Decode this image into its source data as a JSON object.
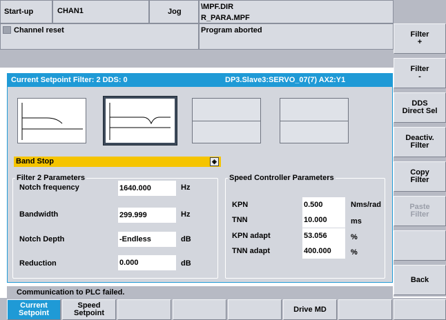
{
  "header": {
    "area": "Start-up",
    "channel": "CHAN1",
    "mode": "Jog",
    "program_dir": "\\MPF.DIR",
    "program_name": "R_PARA.MPF",
    "channel_status": "Channel reset",
    "program_status": "Program aborted"
  },
  "filter_panel": {
    "title_left": "Current Setpoint Filter:  2  DDS: 0",
    "title_right": "DP3.Slave3:SERVO_07(7)  AX2:Y1",
    "selected_filter_type": "Band Stop",
    "filter_group": {
      "title": "Filter 2 Parameters",
      "rows": [
        {
          "label": "Notch frequency",
          "value": "1640.000",
          "unit": "Hz"
        },
        {
          "label": "Bandwidth",
          "value": "299.999",
          "unit": "Hz"
        },
        {
          "label": "Notch Depth",
          "value": "-Endless",
          "unit": "dB"
        },
        {
          "label": "Reduction",
          "value": "0.000",
          "unit": "dB"
        }
      ]
    },
    "speed_group": {
      "title": "Speed Controller Parameters",
      "rows": [
        {
          "label": "KPN",
          "value": "0.500",
          "unit": "Nms/rad"
        },
        {
          "label": "TNN",
          "value": "10.000",
          "unit": "ms"
        },
        {
          "label": "KPN adapt",
          "value": "53.056",
          "unit": "%"
        },
        {
          "label": "TNN adapt",
          "value": "400.000",
          "unit": "%"
        }
      ]
    }
  },
  "status_message": "Communication to PLC failed.",
  "vertical_softkeys": [
    {
      "label": "Filter\n+",
      "enabled": true
    },
    {
      "label": "Filter\n-",
      "enabled": true
    },
    {
      "label": "DDS\nDirect Sel",
      "enabled": true
    },
    {
      "label": "Deactiv.\nFilter",
      "enabled": true
    },
    {
      "label": "Copy\nFilter",
      "enabled": true
    },
    {
      "label": "Paste\nFilter",
      "enabled": false
    },
    {
      "label": "",
      "enabled": true
    },
    {
      "label": "Back",
      "enabled": true
    }
  ],
  "horizontal_softkeys": [
    {
      "label": "Current\nSetpoint",
      "active": true
    },
    {
      "label": "Speed\nSetpoint",
      "active": false
    },
    {
      "label": "",
      "active": false
    },
    {
      "label": "",
      "active": false
    },
    {
      "label": "",
      "active": false
    },
    {
      "label": "Drive MD",
      "active": false
    },
    {
      "label": "",
      "active": false
    },
    {
      "label": "",
      "active": false
    }
  ],
  "colors": {
    "accent_blue": "#1f9ad6",
    "filter_type_yellow": "#f5c400",
    "panel_gray": "#d3d6dd"
  }
}
